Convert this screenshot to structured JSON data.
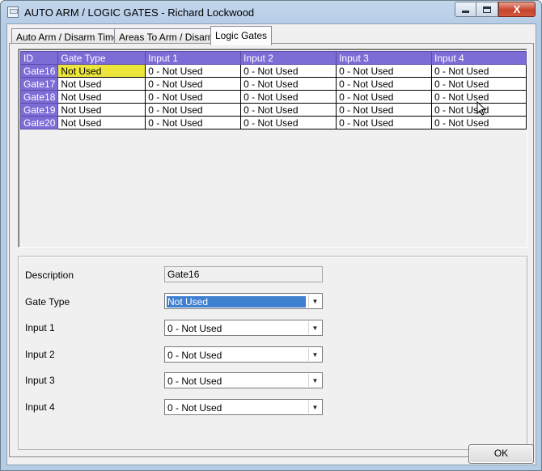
{
  "window": {
    "title": "AUTO ARM / LOGIC GATES - Richard Lockwood"
  },
  "tabs": [
    {
      "label": "Auto Arm / Disarm Timer"
    },
    {
      "label": "Areas To Arm / Disarm"
    },
    {
      "label": "Logic Gates"
    }
  ],
  "grid": {
    "columns": [
      "ID",
      "Gate Type",
      "Input 1",
      "Input 2",
      "Input 3",
      "Input 4"
    ],
    "rows": [
      {
        "id": "Gate16",
        "gate_type": "Not Used",
        "in1": "0 - Not Used",
        "in2": "0 - Not Used",
        "in3": "0 - Not Used",
        "in4": "0 - Not Used"
      },
      {
        "id": "Gate17",
        "gate_type": "Not Used",
        "in1": "0 - Not Used",
        "in2": "0 - Not Used",
        "in3": "0 - Not Used",
        "in4": "0 - Not Used"
      },
      {
        "id": "Gate18",
        "gate_type": "Not Used",
        "in1": "0 - Not Used",
        "in2": "0 - Not Used",
        "in3": "0 - Not Used",
        "in4": "0 - Not Used"
      },
      {
        "id": "Gate19",
        "gate_type": "Not Used",
        "in1": "0 - Not Used",
        "in2": "0 - Not Used",
        "in3": "0 - Not Used",
        "in4": "0 - Not Used"
      },
      {
        "id": "Gate20",
        "gate_type": "Not Used",
        "in1": "0 - Not Used",
        "in2": "0 - Not Used",
        "in3": "0 - Not Used",
        "in4": "0 - Not Used"
      }
    ]
  },
  "detail": {
    "description_label": "Description",
    "description_value": "Gate16",
    "gate_type_label": "Gate Type",
    "gate_type_value": "Not Used",
    "input1_label": "Input 1",
    "input1_value": "0 - Not Used",
    "input2_label": "Input 2",
    "input2_value": "0 - Not Used",
    "input3_label": "Input 3",
    "input3_value": "0 - Not Used",
    "input4_label": "Input 4",
    "input4_value": "0 - Not Used"
  },
  "buttons": {
    "ok_label": "OK",
    "close_glyph": "X"
  },
  "colors": {
    "grid_header": "#7c6cd6",
    "selected_cell": "#ede63a",
    "selection_highlight": "#3f7fd0"
  }
}
